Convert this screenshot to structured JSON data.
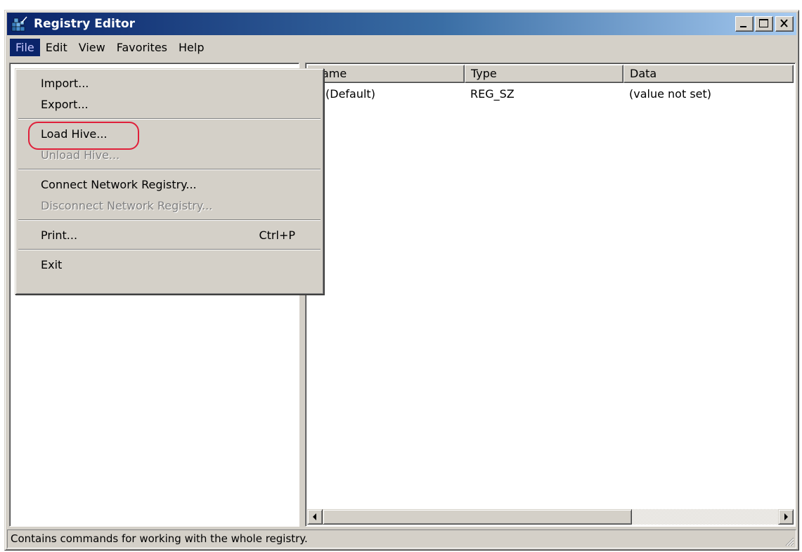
{
  "window": {
    "title": "Registry Editor",
    "title_buttons": [
      "minimize",
      "maximize",
      "close"
    ]
  },
  "menubar": {
    "items": [
      "File",
      "Edit",
      "View",
      "Favorites",
      "Help"
    ],
    "active": "File"
  },
  "file_menu": {
    "import": "Import...",
    "export": "Export...",
    "load_hive": "Load Hive...",
    "unload_hive": "Unload Hive...",
    "connect": "Connect Network Registry...",
    "disconnect": "Disconnect Network Registry...",
    "print": "Print...",
    "print_shortcut": "Ctrl+P",
    "exit": "Exit",
    "disabled_items": [
      "Unload Hive...",
      "Disconnect Network Registry..."
    ],
    "highlight_color": "#e0203a"
  },
  "list": {
    "columns": [
      "Name",
      "Type",
      "Data"
    ],
    "rows": [
      {
        "name": "(Default)",
        "type": "REG_SZ",
        "data": "(value not set)",
        "icon": "string-value-icon"
      }
    ]
  },
  "statusbar": {
    "text": "Contains commands for working with the whole registry."
  },
  "colors": {
    "face": "#d4d0c8",
    "title_start": "#0a246a",
    "title_end": "#a6caf0",
    "menu_active_bg": "#0a246a"
  }
}
